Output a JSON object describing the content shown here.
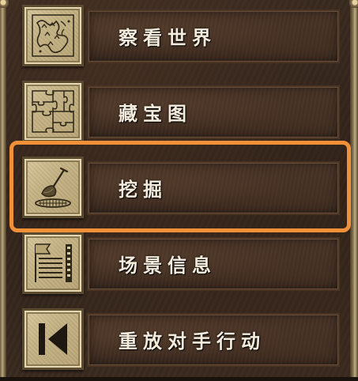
{
  "menu": {
    "items": [
      {
        "label": "察看世界",
        "icon": "world-map-icon"
      },
      {
        "label": "藏宝图",
        "icon": "puzzle-map-icon"
      },
      {
        "label": "挖掘",
        "icon": "shovel-dig-icon"
      },
      {
        "label": "场景信息",
        "icon": "scenario-info-icon"
      },
      {
        "label": "重放对手行动",
        "icon": "replay-opponent-icon"
      }
    ],
    "selected_index": 2
  },
  "colors": {
    "highlight": "#f0913a",
    "label_text": "#f3ecdc",
    "tile": "#c4b283"
  }
}
